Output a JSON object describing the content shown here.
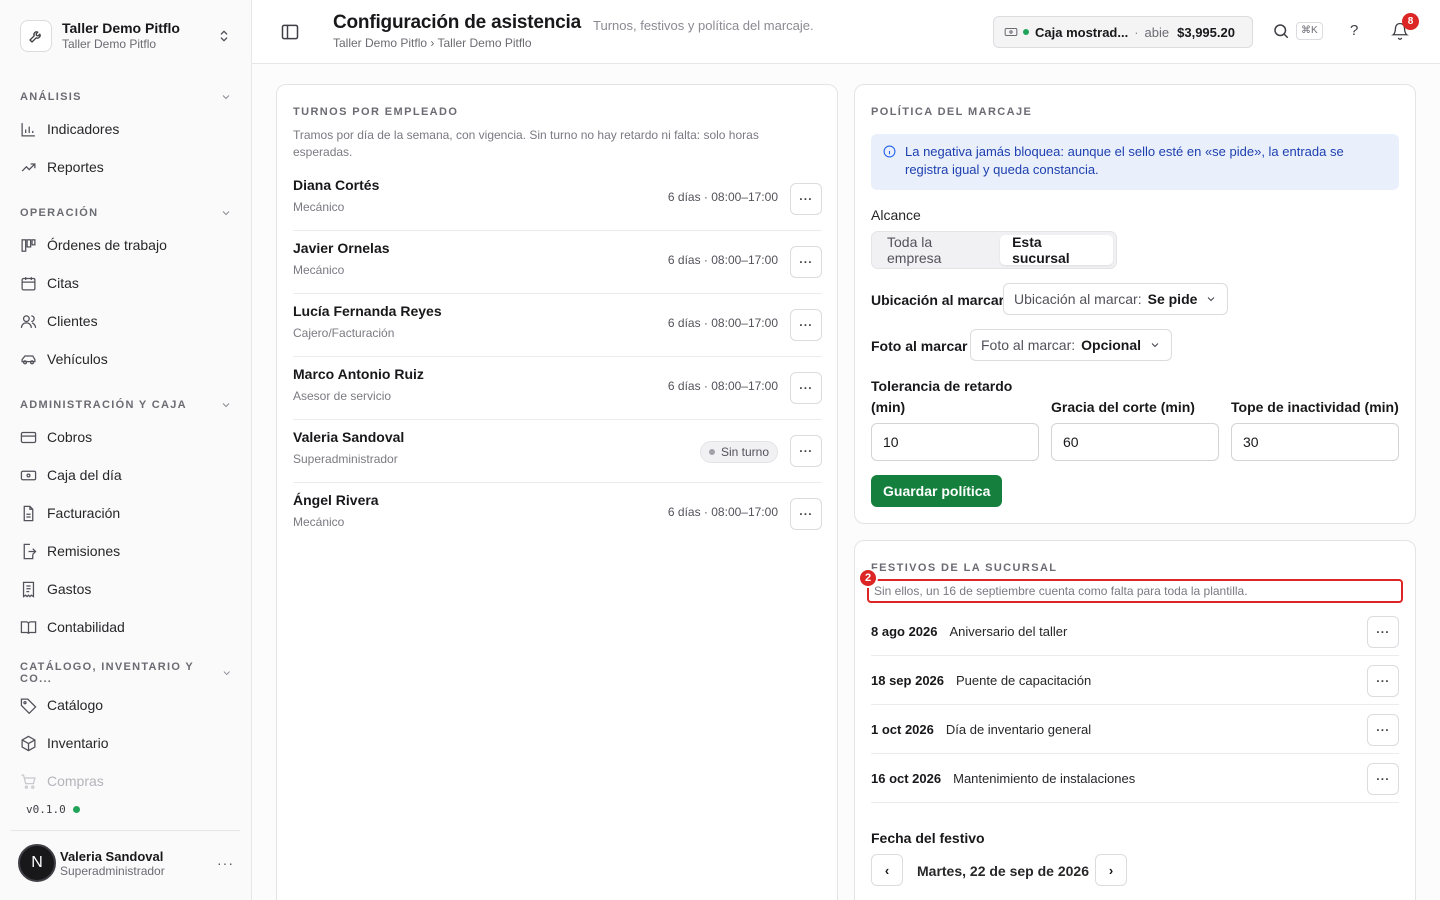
{
  "org": {
    "name": "Taller Demo Pitflo",
    "subtitle": "Taller Demo Pitflo"
  },
  "sidebar": {
    "sections": [
      {
        "title": "ANÁLISIS",
        "items": [
          "Indicadores",
          "Reportes"
        ]
      },
      {
        "title": "OPERACIÓN",
        "items": [
          "Órdenes de trabajo",
          "Citas",
          "Clientes",
          "Vehículos"
        ]
      },
      {
        "title": "ADMINISTRACIÓN Y CAJA",
        "items": [
          "Cobros",
          "Caja del día",
          "Facturación",
          "Remisiones",
          "Gastos",
          "Contabilidad"
        ]
      },
      {
        "title": "CATÁLOGO, INVENTARIO Y CO...",
        "items": [
          "Catálogo",
          "Inventario",
          "Compras"
        ]
      }
    ],
    "version": "v0.1.0",
    "user": {
      "initial": "N",
      "name": "Valeria Sandoval",
      "role": "Superadministrador"
    }
  },
  "header": {
    "title": "Configuración de asistencia",
    "subtitle": "Turnos, festivos y política del marcaje.",
    "breadcrumb": "Taller Demo Pitflo › Taller Demo Pitflo",
    "cash": {
      "name": "Caja mostrad...",
      "sep": "·",
      "state": "abie",
      "amount": "$3,995.20"
    },
    "shortcut": "⌘K",
    "help": "?",
    "notifications": "8"
  },
  "shifts": {
    "label": "TURNOS POR EMPLEADO",
    "description": "Tramos por día de la semana, con vigencia. Sin turno no hay retardo ni falta: solo horas esperadas.",
    "employees": [
      {
        "name": "Diana Cortés",
        "role": "Mecánico",
        "schedule": "6 días · 08:00–17:00"
      },
      {
        "name": "Javier Ornelas",
        "role": "Mecánico",
        "schedule": "6 días · 08:00–17:00"
      },
      {
        "name": "Lucía Fernanda Reyes",
        "role": "Cajero/Facturación",
        "schedule": "6 días · 08:00–17:00"
      },
      {
        "name": "Marco Antonio Ruiz",
        "role": "Asesor de servicio",
        "schedule": "6 días · 08:00–17:00"
      },
      {
        "name": "Valeria Sandoval",
        "role": "Superadministrador",
        "schedule": "Sin turno"
      },
      {
        "name": "Ángel Rivera",
        "role": "Mecánico",
        "schedule": "6 días · 08:00–17:00"
      }
    ],
    "more": "···"
  },
  "policy": {
    "label": "POLÍTICA DEL MARCAJE",
    "info": "La negativa jamás bloquea: aunque el sello esté en «se pide», la entrada se registra igual y queda constancia.",
    "scope_label": "Alcance",
    "scope_options": [
      "Toda la empresa",
      "Esta sucursal"
    ],
    "location_label": "Ubicación al marcar",
    "location_select": {
      "prefix": "Ubicación al marcar:",
      "value": "Se pide"
    },
    "photo_label": "Foto al marcar",
    "photo_select": {
      "prefix": "Foto al marcar:",
      "value": "Opcional"
    },
    "tolerance_label_1": "Tolerancia de retardo",
    "tolerance_label_2": "(min)",
    "tolerance_value": "10",
    "grace_label": "Gracia del corte (min)",
    "grace_value": "60",
    "inactivity_label": "Tope de inactividad (min)",
    "inactivity_value": "30",
    "save": "Guardar política"
  },
  "holidays": {
    "label": "FESTIVOS DE LA SUCURSAL",
    "marker": "2",
    "description": "Sin ellos, un 16 de septiembre cuenta como falta para toda la plantilla.",
    "items": [
      {
        "date": "8 ago 2026",
        "name": "Aniversario del taller"
      },
      {
        "date": "18 sep 2026",
        "name": "Puente de capacitación"
      },
      {
        "date": "1 oct 2026",
        "name": "Día de inventario general"
      },
      {
        "date": "16 oct 2026",
        "name": "Mantenimiento de instalaciones"
      }
    ],
    "date_label": "Fecha del festivo",
    "date_value": "Martes, 22 de sep de 2026",
    "prev": "‹",
    "next": "›"
  }
}
